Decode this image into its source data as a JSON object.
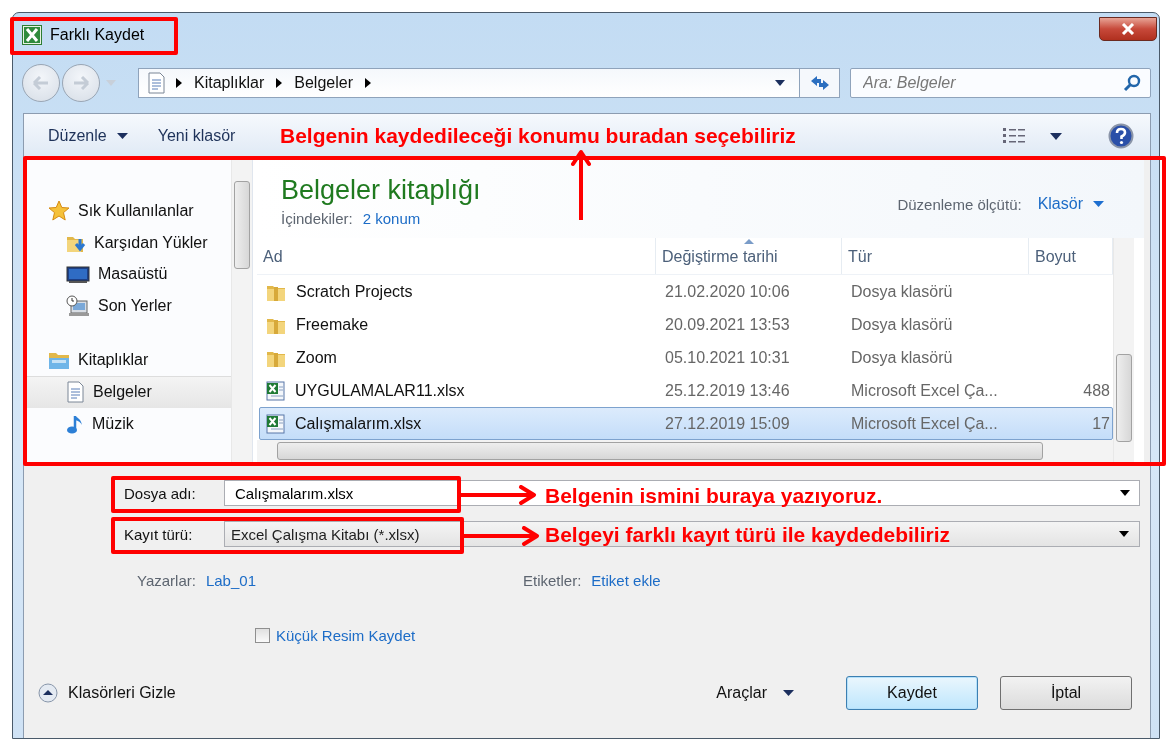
{
  "window": {
    "title": "Farklı Kaydet"
  },
  "address": {
    "breadcrumbs": [
      "Kitaplıklar",
      "Belgeler"
    ]
  },
  "search": {
    "placeholder": "Ara: Belgeler"
  },
  "toolbar": {
    "organize": "Düzenle",
    "new_folder": "Yeni klasör"
  },
  "nav": {
    "items": [
      {
        "label": "Sık Kullanılanlar",
        "kind": "favorites",
        "selected": false,
        "children": [
          {
            "label": "Karşıdan Yükler",
            "kind": "downloads",
            "selected": false
          },
          {
            "label": "Masaüstü",
            "kind": "desktop",
            "selected": false
          },
          {
            "label": "Son Yerler",
            "kind": "recent",
            "selected": false
          }
        ]
      },
      {
        "label": "Kitaplıklar",
        "kind": "libraries",
        "selected": false,
        "children": [
          {
            "label": "Belgeler",
            "kind": "documents",
            "selected": true
          },
          {
            "label": "Müzik",
            "kind": "music",
            "selected": false
          }
        ]
      }
    ]
  },
  "library": {
    "title": "Belgeler kitaplığı",
    "includes_label": "İçindekiler:",
    "includes_link": "2 konum",
    "arrange_label": "Düzenleme ölçütü:",
    "arrange_value": "Klasör"
  },
  "table": {
    "columns": [
      {
        "label": "Ad",
        "sorted": false
      },
      {
        "label": "Değiştirme tarihi",
        "sorted": true
      },
      {
        "label": "Tür",
        "sorted": false
      },
      {
        "label": "Boyut",
        "sorted": false
      }
    ],
    "rows": [
      {
        "kind": "folder",
        "name": "Scratch Projects",
        "date": "21.02.2020 10:06",
        "type": "Dosya klasörü",
        "selected": false
      },
      {
        "kind": "folder",
        "name": "Freemake",
        "date": "20.09.2021 13:53",
        "type": "Dosya klasörü",
        "selected": false
      },
      {
        "kind": "folder",
        "name": "Zoom",
        "date": "05.10.2021 10:31",
        "type": "Dosya klasörü",
        "selected": false
      },
      {
        "kind": "spreadsheet",
        "name": "UYGULAMALAR11.xlsx",
        "date": "25.12.2019 13:46",
        "type": "Microsoft Excel Ça...",
        "size": "488",
        "selected": false
      },
      {
        "kind": "spreadsheet",
        "name": "Calışmalarım.xlsx",
        "date": "27.12.2019 15:09",
        "type": "Microsoft Excel Ça...",
        "size": "17",
        "selected": true
      }
    ]
  },
  "form": {
    "file_name": {
      "label": "Dosya adı:",
      "value": "Calışmalarım.xlsx"
    },
    "file_type": {
      "label": "Kayıt türü:",
      "value": "Excel Çalışma Kitabı (*.xlsx)"
    },
    "authors": {
      "label": "Yazarlar:",
      "value": "Lab_01"
    },
    "tags": {
      "label": "Etiketler:",
      "value": "Etiket ekle"
    },
    "thumbnail": {
      "label": "Küçük Resim Kaydet",
      "checked": false
    }
  },
  "footer": {
    "hide_folders": "Klasörleri Gizle",
    "tools": "Araçlar",
    "save": "Kaydet",
    "cancel": "İptal"
  },
  "annotations": [
    {
      "kind": "location",
      "text": "Belgenin kaydedileceği konumu buradan seçebiliriz"
    },
    {
      "kind": "file_name",
      "text": "Belgenin ismini buraya yazıyoruz."
    },
    {
      "kind": "file_type",
      "text": "Belgeyi farklı kayıt türü ile kaydedebiliriz"
    }
  ]
}
